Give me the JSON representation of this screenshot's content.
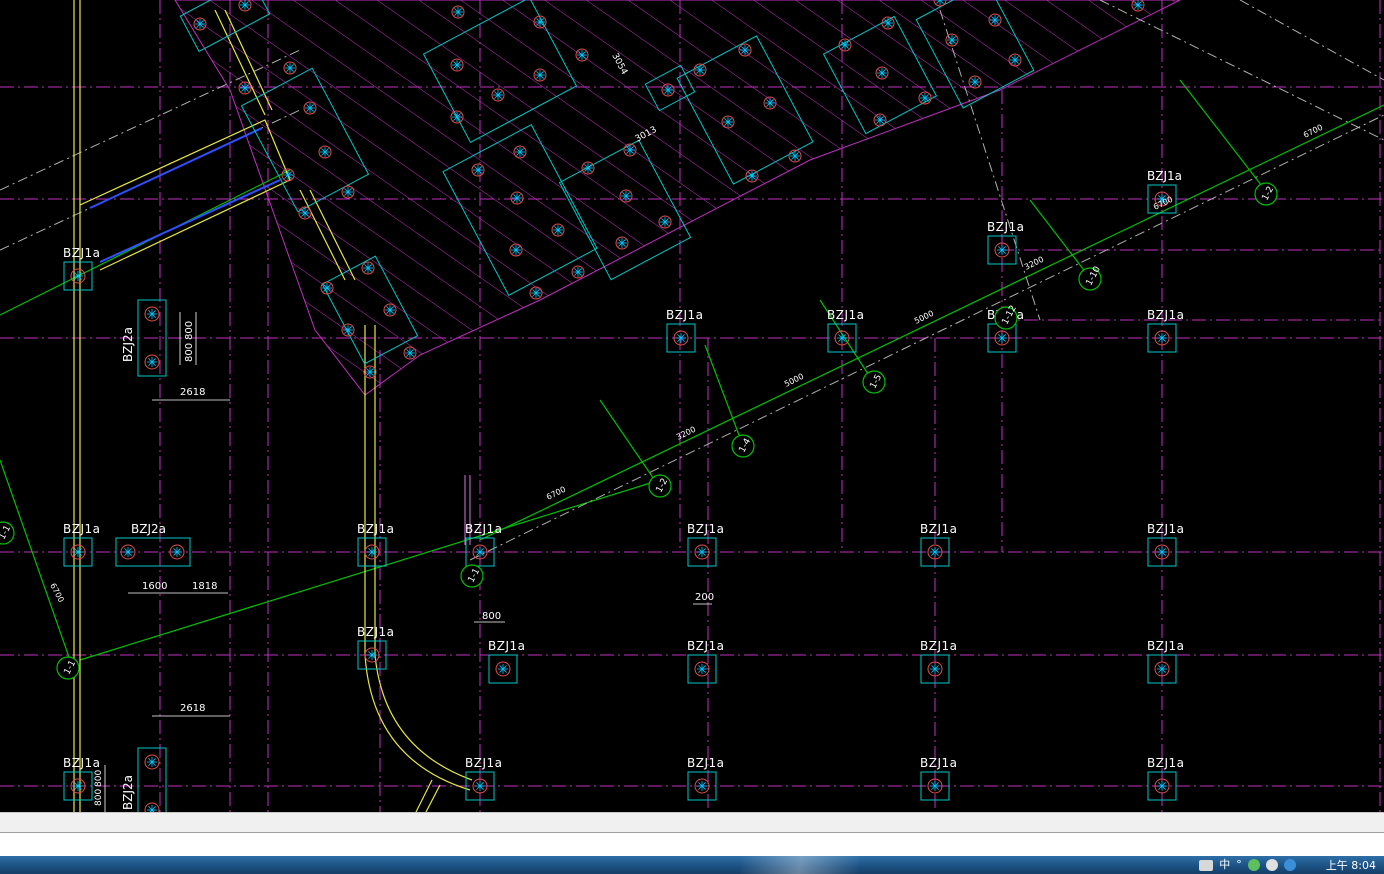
{
  "drawing": {
    "colors": {
      "background": "#000000",
      "gridline": "#c030c0",
      "footing": "#00c8c8",
      "axis": "#00d000",
      "wall": "#e8e840",
      "text": "#ffffff",
      "hatch": "#c030c0"
    },
    "footing_labels": [
      "BZJ1a",
      "BZJ1a",
      "BZJ1a",
      "BZJ1a",
      "BZJ1a",
      "BZJ1a",
      "BZJ1a",
      "BZJ2a",
      "BZJ1a",
      "BZJ1a",
      "BZJ1a",
      "BZJ1a",
      "BZJ1a",
      "BZJ1a",
      "BZJ1a",
      "BZJ1a",
      "BZJ1a",
      "BZJ1a",
      "BZJ1a",
      "BZJ1a",
      "BZJ1a",
      "BZJ1a",
      "BZJ1a",
      "BZJ2a",
      "BZJ2a"
    ],
    "dimensions": [
      "2618",
      "800",
      "800",
      "1600",
      "1818",
      "800",
      "200",
      "2618",
      "800",
      "800",
      "6700",
      "3200",
      "5000",
      "5000",
      "3200",
      "6700",
      "6700",
      "3200",
      "6700",
      "3013",
      "3054"
    ],
    "axis_labels": [
      "1-2",
      "1-4",
      "1-5",
      "1-10",
      "1-12",
      "1-11",
      "1-1",
      "1-1"
    ]
  },
  "taskbar": {
    "tray_text": [
      "中",
      "°"
    ],
    "tray_icons": [
      "ime-icon",
      "network-icon",
      "volume-icon",
      "shield-icon"
    ],
    "clock": "上午 8:04"
  }
}
